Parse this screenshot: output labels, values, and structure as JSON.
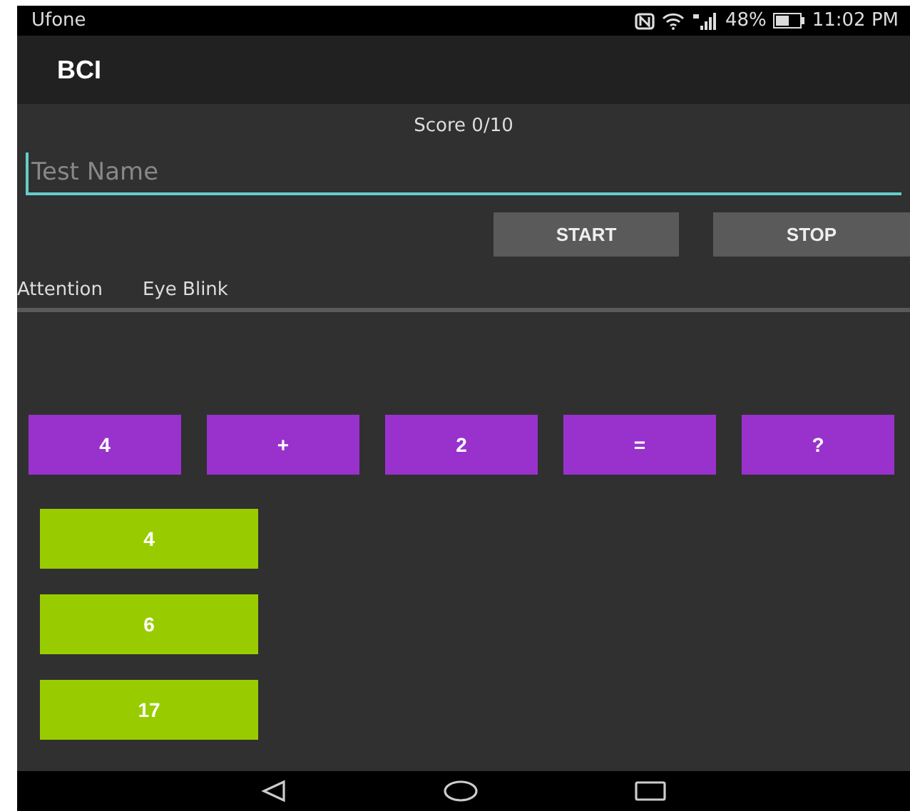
{
  "status_bar": {
    "carrier": "Ufone",
    "battery": "48%",
    "time": "11:02 PM"
  },
  "app_bar": {
    "title": "BCI"
  },
  "score": "Score 0/10",
  "test_name": {
    "placeholder": "Test Name"
  },
  "buttons": [
    "START",
    "STOP"
  ],
  "labels": [
    "Attention",
    "Eye Blink"
  ],
  "equation": [
    "4",
    "+",
    "2",
    "=",
    "?"
  ],
  "answers": [
    "4",
    "6",
    "17"
  ]
}
